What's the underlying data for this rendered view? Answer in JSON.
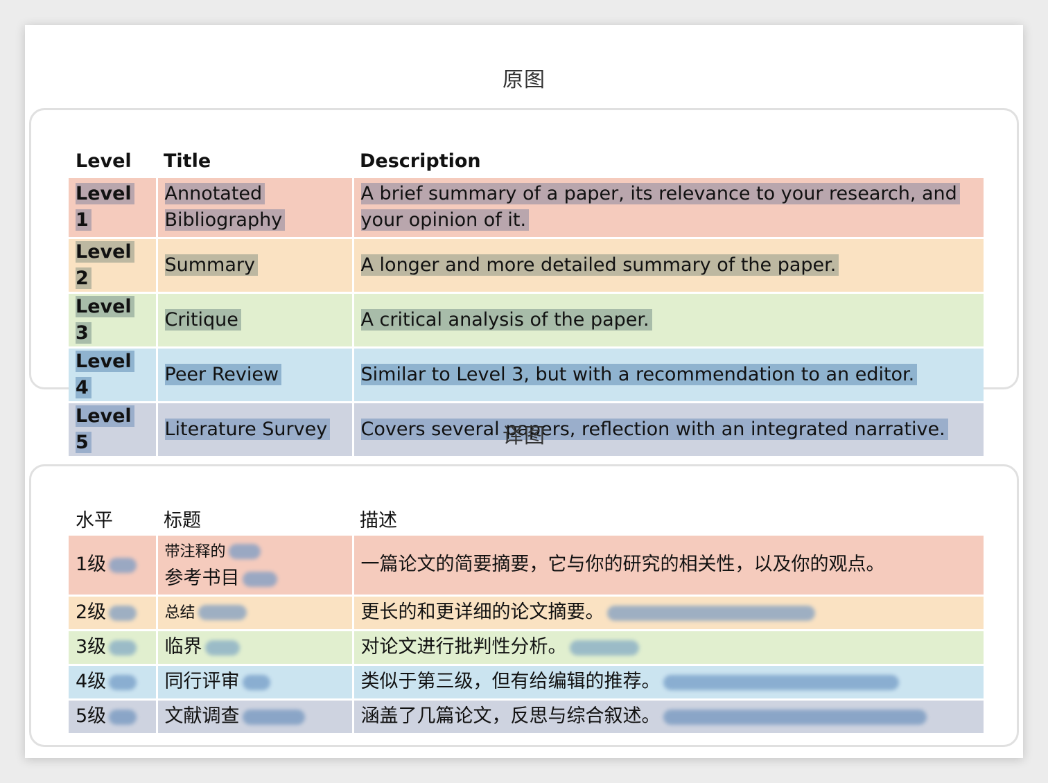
{
  "original": {
    "heading": "原图",
    "headers": {
      "level": "Level",
      "title": "Title",
      "description": "Description"
    },
    "rows": [
      {
        "level": "Level 1",
        "title_line1": "Annotated",
        "title_line2": "Bibliography",
        "description": "A brief summary of a paper, its relevance to your research, and your opinion of it."
      },
      {
        "level": "Level 2",
        "title": "Summary",
        "description": "A longer and more detailed summary of the paper."
      },
      {
        "level": "Level 3",
        "title": "Critique",
        "description": "A critical analysis of the paper."
      },
      {
        "level": "Level 4",
        "title": "Peer Review",
        "description": "Similar to Level 3, but with a recommendation to an editor."
      },
      {
        "level": "Level 5",
        "title": "Literature Survey",
        "description": "Covers several papers, reflection with an integrated narrative."
      }
    ]
  },
  "translated": {
    "heading": "译图",
    "headers": {
      "level": "水平",
      "title": "标题",
      "description": "描述"
    },
    "rows": [
      {
        "level": "1级",
        "title_line1": "带注释的",
        "title_line2": "参考书目",
        "description": "一篇论文的简要摘要，它与你的研究的相关性，以及你的观点。"
      },
      {
        "level": "2级",
        "title": "总结",
        "description": "更长的和更详细的论文摘要。"
      },
      {
        "level": "3级",
        "title": "临界",
        "description": "对论文进行批判性分析。"
      },
      {
        "level": "4级",
        "title": "同行评审",
        "description": "类似于第三级，但有给编辑的推荐。"
      },
      {
        "level": "5级",
        "title": "文献调查",
        "description": "涵盖了几篇论文，反思与综合叙述。"
      }
    ]
  },
  "colors": {
    "level1": "#f5cbbd",
    "level2": "#fae2c2",
    "level3": "#e1efcf",
    "level4": "#cbe4f0",
    "level5": "#ced3e0"
  }
}
